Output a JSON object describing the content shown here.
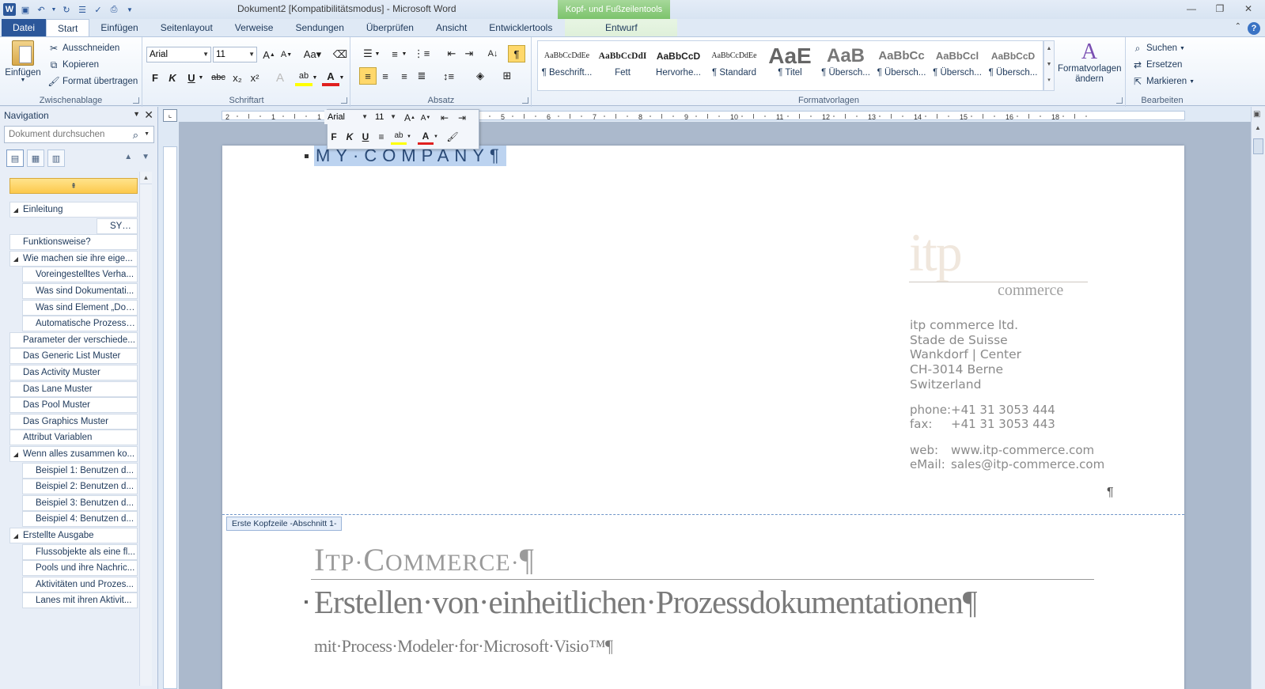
{
  "window": {
    "title": "Dokument2 [Kompatibilitätsmodus]  -  Microsoft Word",
    "context_tab_group": "Kopf- und Fußzeilentools"
  },
  "tabs": [
    "Datei",
    "Start",
    "Einfügen",
    "Seitenlayout",
    "Verweise",
    "Sendungen",
    "Überprüfen",
    "Ansicht",
    "Entwicklertools",
    "Entwurf"
  ],
  "ribbon": {
    "clipboard": {
      "paste": "Einfügen",
      "cut": "Ausschneiden",
      "copy": "Kopieren",
      "format_painter": "Format übertragen",
      "label": "Zwischenablage"
    },
    "font": {
      "font_name": "Arial",
      "font_size": "11",
      "label": "Schriftart"
    },
    "paragraph": {
      "label": "Absatz"
    },
    "styles": {
      "label": "Formatvorlagen",
      "items": [
        {
          "sample": "AaBbCcDdEe",
          "name": "¶ Beschrift..."
        },
        {
          "sample": "AaBbCcDdI",
          "name": "Fett"
        },
        {
          "sample": "AaBbCcD",
          "name": "Hervorhe..."
        },
        {
          "sample": "AaBbCcDdEe",
          "name": "¶ Standard"
        },
        {
          "sample": "AaE",
          "name": "¶ Titel"
        },
        {
          "sample": "AaB",
          "name": "¶ Übersch..."
        },
        {
          "sample": "AaBbCc",
          "name": "¶ Übersch..."
        },
        {
          "sample": "AaBbCcl",
          "name": "¶ Übersch..."
        },
        {
          "sample": "AaBbCcD",
          "name": "¶ Übersch..."
        }
      ],
      "change_styles": "Formatvorlagen ändern"
    },
    "editing": {
      "find": "Suchen",
      "replace": "Ersetzen",
      "select": "Markieren",
      "label": "Bearbeiten"
    }
  },
  "navigation": {
    "title": "Navigation",
    "search_placeholder": "Dokument durchsuchen",
    "items": [
      {
        "label": "Einleitung",
        "level": 1,
        "expandable": true
      },
      {
        "label": "SYM...",
        "level": 3,
        "expandable": false
      },
      {
        "label": "Funktionsweise?",
        "level": 1,
        "expandable": false
      },
      {
        "label": "Wie machen sie ihre eige...",
        "level": 1,
        "expandable": true
      },
      {
        "label": "Voreingestelltes Verha...",
        "level": 2,
        "expandable": false
      },
      {
        "label": "Was sind Dokumentati...",
        "level": 2,
        "expandable": false
      },
      {
        "label": "Was sind Element „Doc...",
        "level": 2,
        "expandable": false
      },
      {
        "label": "Automatische Prozessd...",
        "level": 2,
        "expandable": false
      },
      {
        "label": "Parameter der verschiede...",
        "level": 1,
        "expandable": false
      },
      {
        "label": "Das Generic List Muster",
        "level": 1,
        "expandable": false
      },
      {
        "label": "Das Activity Muster",
        "level": 1,
        "expandable": false
      },
      {
        "label": "Das Lane Muster",
        "level": 1,
        "expandable": false
      },
      {
        "label": "Das Pool Muster",
        "level": 1,
        "expandable": false
      },
      {
        "label": "Das Graphics Muster",
        "level": 1,
        "expandable": false
      },
      {
        "label": "Attribut Variablen",
        "level": 1,
        "expandable": false
      },
      {
        "label": "Wenn alles zusammen ko...",
        "level": 1,
        "expandable": true
      },
      {
        "label": "Beispiel 1: Benutzen d...",
        "level": 2,
        "expandable": false
      },
      {
        "label": "Beispiel 2: Benutzen d...",
        "level": 2,
        "expandable": false
      },
      {
        "label": "Beispiel 3: Benutzen d...",
        "level": 2,
        "expandable": false
      },
      {
        "label": "Beispiel 4: Benutzen d...",
        "level": 2,
        "expandable": false
      },
      {
        "label": "Erstellte Ausgabe",
        "level": 1,
        "expandable": true
      },
      {
        "label": "Flussobjekte als eine fl...",
        "level": 2,
        "expandable": false
      },
      {
        "label": "Pools und ihre Nachric...",
        "level": 2,
        "expandable": false
      },
      {
        "label": "Aktivitäten und Prozes...",
        "level": 2,
        "expandable": false
      },
      {
        "label": "Lanes mit ihren Aktivit...",
        "level": 2,
        "expandable": false
      }
    ]
  },
  "ruler": {
    "numbers": [
      "2",
      "1",
      "1",
      "2",
      "3",
      "4",
      "5",
      "6",
      "7",
      "8",
      "9",
      "10",
      "11",
      "12",
      "13",
      "14",
      "15",
      "16",
      "18"
    ]
  },
  "document": {
    "header_text": "MY·COMPANY¶",
    "logo_text": "itp",
    "logo_sub": "commerce",
    "address_lines": [
      "itp commerce ltd.",
      "Stade de Suisse",
      "Wankdorf | Center",
      "CH-3014 Berne",
      "Switzerland"
    ],
    "phone_label": "phone:",
    "phone": "+41 31 3053 444",
    "fax_label": "fax:",
    "fax": "+41 31 3053 443",
    "web_label": "web:",
    "web": "www.itp-commerce.com",
    "email_label": "eMail:",
    "email": "sales@itp-commerce.com",
    "pilcrow": "¶",
    "header_section_label": "Erste Kopfzeile -Abschnitt 1-",
    "company_title_I": "I",
    "company_title_tp": "TP·",
    "company_title_C": "C",
    "company_title_ommerce": "OMMERCE·",
    "company_title_end": "¶",
    "main_heading": "Erstellen·von·einheitlichen·Prozessdokumentationen¶",
    "sub_heading": "mit·Process·Modeler·for·Microsoft·Visio™¶"
  },
  "mini_toolbar": {
    "font_name": "Arial",
    "font_size": "11"
  }
}
